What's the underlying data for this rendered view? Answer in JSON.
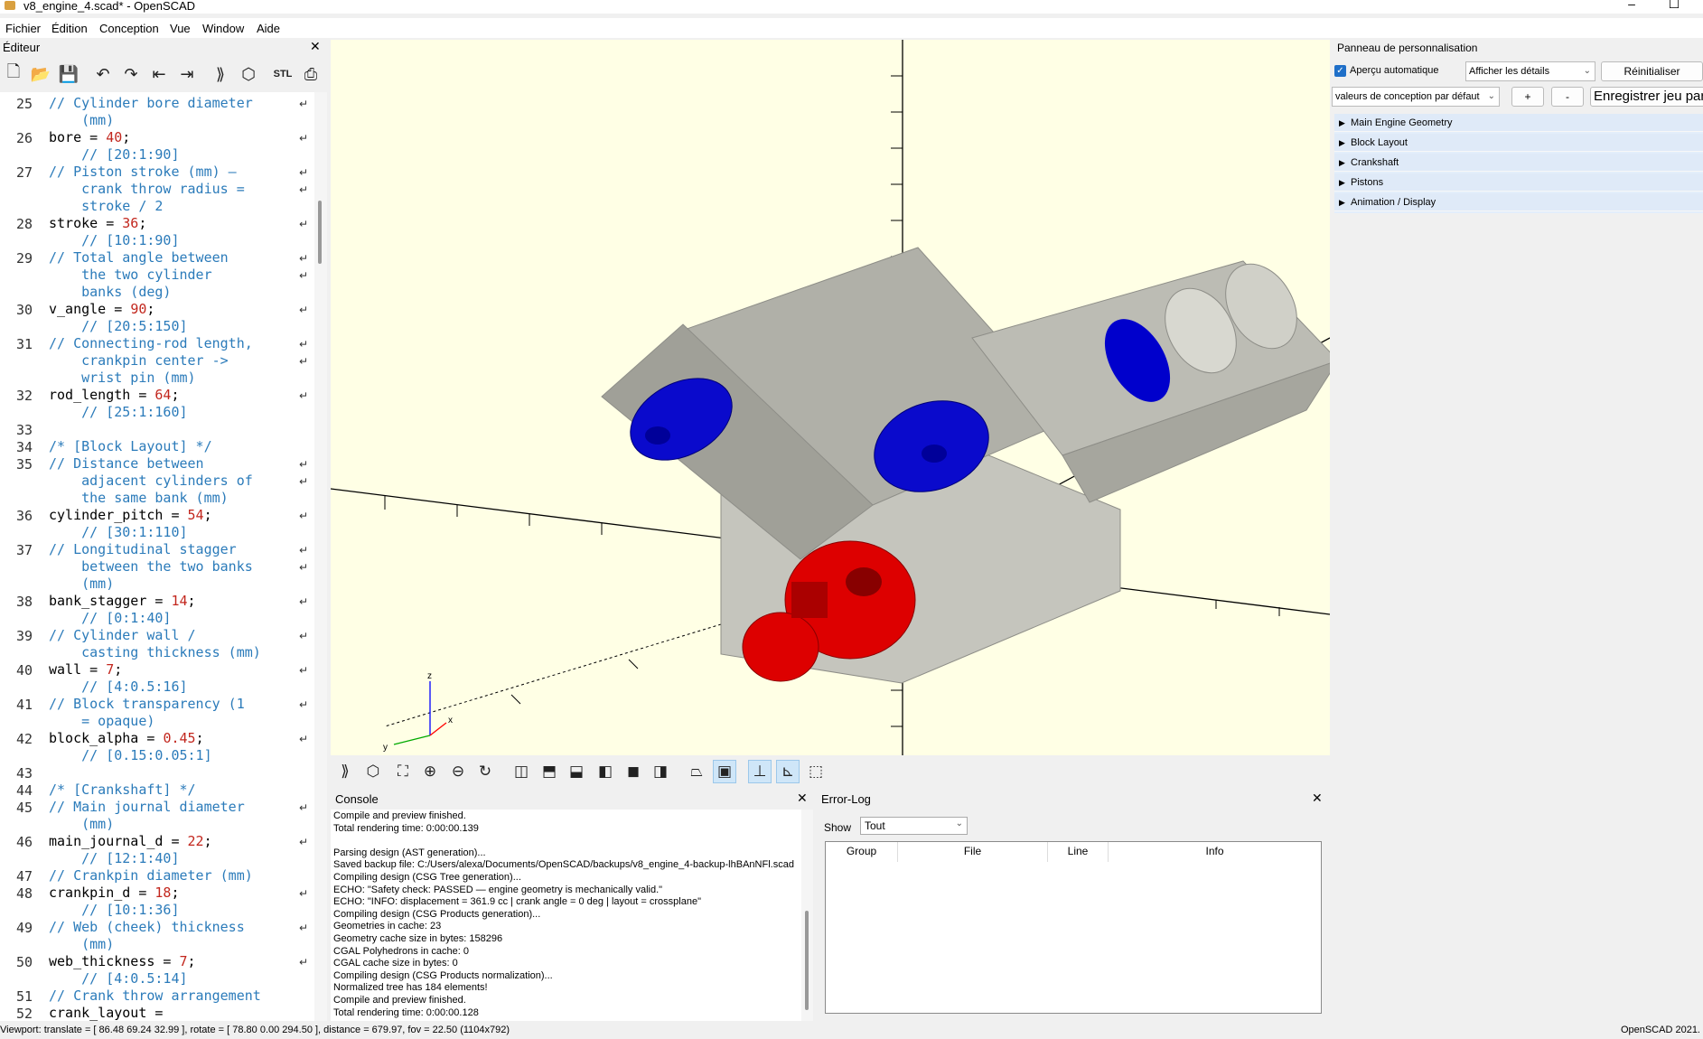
{
  "window": {
    "title": "v8_engine_4.scad* - OpenSCAD"
  },
  "menu": [
    "Fichier",
    "Édition",
    "Conception",
    "Vue",
    "Window",
    "Aide"
  ],
  "editor": {
    "title": "Éditeur",
    "lines": [
      {
        "n": "25",
        "t": "// Cylinder bore diameter",
        "type": "c"
      },
      {
        "n": "",
        "t": "    (mm)",
        "type": "c"
      },
      {
        "n": "26",
        "t": "bore = ",
        "v": "40",
        "type": "k"
      },
      {
        "n": "",
        "t": "    // [20:1:90]",
        "type": "c"
      },
      {
        "n": "27",
        "t": "// Piston stroke (mm) —",
        "type": "c"
      },
      {
        "n": "",
        "t": "    crank throw radius =",
        "type": "c"
      },
      {
        "n": "",
        "t": "    stroke / 2",
        "type": "c"
      },
      {
        "n": "28",
        "t": "stroke = ",
        "v": "36",
        "type": "k"
      },
      {
        "n": "",
        "t": "    // [10:1:90]",
        "type": "c"
      },
      {
        "n": "29",
        "t": "// Total angle between",
        "type": "c"
      },
      {
        "n": "",
        "t": "    the two cylinder",
        "type": "c"
      },
      {
        "n": "",
        "t": "    banks (deg)",
        "type": "c"
      },
      {
        "n": "30",
        "t": "v_angle = ",
        "v": "90",
        "type": "k"
      },
      {
        "n": "",
        "t": "    // [20:5:150]",
        "type": "c"
      },
      {
        "n": "31",
        "t": "// Connecting-rod length,",
        "type": "c"
      },
      {
        "n": "",
        "t": "    crankpin center ->",
        "type": "c"
      },
      {
        "n": "",
        "t": "    wrist pin (mm)",
        "type": "c"
      },
      {
        "n": "32",
        "t": "rod_length = ",
        "v": "64",
        "type": "k"
      },
      {
        "n": "",
        "t": "    // [25:1:160]",
        "type": "c"
      },
      {
        "n": "33",
        "t": "",
        "type": "k"
      },
      {
        "n": "34",
        "t": "/* [Block Layout] */",
        "type": "c"
      },
      {
        "n": "35",
        "t": "// Distance between",
        "type": "c"
      },
      {
        "n": "",
        "t": "    adjacent cylinders of",
        "type": "c"
      },
      {
        "n": "",
        "t": "    the same bank (mm)",
        "type": "c"
      },
      {
        "n": "36",
        "t": "cylinder_pitch = ",
        "v": "54",
        "type": "k"
      },
      {
        "n": "",
        "t": "    // [30:1:110]",
        "type": "c"
      },
      {
        "n": "37",
        "t": "// Longitudinal stagger",
        "type": "c"
      },
      {
        "n": "",
        "t": "    between the two banks",
        "type": "c"
      },
      {
        "n": "",
        "t": "    (mm)",
        "type": "c"
      },
      {
        "n": "38",
        "t": "bank_stagger = ",
        "v": "14",
        "type": "k"
      },
      {
        "n": "",
        "t": "    // [0:1:40]",
        "type": "c"
      },
      {
        "n": "39",
        "t": "// Cylinder wall /",
        "type": "c"
      },
      {
        "n": "",
        "t": "    casting thickness (mm)",
        "type": "c"
      },
      {
        "n": "40",
        "t": "wall = ",
        "v": "7",
        "type": "k"
      },
      {
        "n": "",
        "t": "    // [4:0.5:16]",
        "type": "c"
      },
      {
        "n": "41",
        "t": "// Block transparency (1",
        "type": "c"
      },
      {
        "n": "",
        "t": "    = opaque)",
        "type": "c"
      },
      {
        "n": "42",
        "t": "block_alpha = ",
        "v": "0.45",
        "type": "k"
      },
      {
        "n": "",
        "t": "    // [0.15:0.05:1]",
        "type": "c"
      },
      {
        "n": "43",
        "t": "",
        "type": "k"
      },
      {
        "n": "44",
        "t": "/* [Crankshaft] */",
        "type": "c"
      },
      {
        "n": "45",
        "t": "// Main journal diameter",
        "type": "c"
      },
      {
        "n": "",
        "t": "    (mm)",
        "type": "c"
      },
      {
        "n": "46",
        "t": "main_journal_d = ",
        "v": "22",
        "type": "k"
      },
      {
        "n": "",
        "t": "    // [12:1:40]",
        "type": "c"
      },
      {
        "n": "47",
        "t": "// Crankpin diameter (mm)",
        "type": "c"
      },
      {
        "n": "48",
        "t": "crankpin_d = ",
        "v": "18",
        "type": "k"
      },
      {
        "n": "",
        "t": "    // [10:1:36]",
        "type": "c"
      },
      {
        "n": "49",
        "t": "// Web (cheek) thickness",
        "type": "c"
      },
      {
        "n": "",
        "t": "    (mm)",
        "type": "c"
      },
      {
        "n": "50",
        "t": "web_thickness = ",
        "v": "7",
        "type": "k"
      },
      {
        "n": "",
        "t": "    // [4:0.5:14]",
        "type": "c"
      },
      {
        "n": "51",
        "t": "// Crank throw arrangement",
        "type": "c"
      },
      {
        "n": "52",
        "t": "crank_layout =",
        "type": "k"
      }
    ]
  },
  "console": {
    "title": "Console",
    "lines": [
      "Compile and preview finished.",
      "Total rendering time: 0:00:00.139",
      "",
      "Parsing design (AST generation)...",
      "Saved backup file: C:/Users/alexa/Documents/OpenSCAD/backups/v8_engine_4-backup-lhBAnNFl.scad",
      "Compiling design (CSG Tree generation)...",
      "ECHO: \"Safety check: PASSED — engine geometry is mechanically valid.\"",
      "ECHO: \"INFO: displacement = 361.9 cc | crank angle = 0 deg | layout = crossplane\"",
      "Compiling design (CSG Products generation)...",
      "Geometries in cache: 23",
      "Geometry cache size in bytes: 158296",
      "CGAL Polyhedrons in cache: 0",
      "CGAL cache size in bytes: 0",
      "Compiling design (CSG Products normalization)...",
      "Normalized tree has 184 elements!",
      "Compile and preview finished.",
      "Total rendering time: 0:00:00.128"
    ]
  },
  "errlog": {
    "title": "Error-Log",
    "show_label": "Show",
    "show_value": "Tout",
    "columns": [
      "Group",
      "File",
      "Line",
      "Info"
    ]
  },
  "customizer": {
    "title": "Panneau de personnalisation",
    "auto_preview": "Aperçu automatique",
    "details": "Afficher les détails",
    "reset": "Réinitialiser",
    "preset": "valeurs de conception par défaut",
    "plus": "+",
    "minus": "-",
    "save": "Enregistrer jeu par",
    "sections": [
      "Main Engine Geometry",
      "Block Layout",
      "Crankshaft",
      "Pistons",
      "Animation / Display"
    ]
  },
  "status": {
    "viewport": "Viewport: translate = [ 86.48 69.24 32.99 ], rotate = [ 78.80 0.00 294.50 ], distance = 679.97, fov = 22.50 (1104x792)",
    "version": "OpenSCAD 2021."
  },
  "axes": {
    "x": "x",
    "y": "y",
    "z": "z"
  },
  "colors": {
    "viewport_bg": "#ffffe5",
    "piston": "#0000cc",
    "crank": "#dd0000",
    "block": "#b8b8b0",
    "accent": "#1f6fc8"
  },
  "icons": {
    "editor_toolbar": [
      "new-file-icon",
      "open-file-icon",
      "save-icon",
      "undo-icon",
      "redo-icon",
      "unindent-icon",
      "indent-icon",
      "preview-icon",
      "render-icon",
      "export-stl-icon",
      "send-to-print-icon"
    ],
    "view_toolbar": [
      "preview-icon",
      "render-icon",
      "view-all-icon",
      "zoom-in-icon",
      "zoom-out-icon",
      "reset-view-icon",
      "view-right-icon",
      "view-top-icon",
      "view-bottom-icon",
      "view-left-icon",
      "view-front-icon",
      "view-back-icon",
      "perspective-icon",
      "orthogonal-icon",
      "show-axes-icon",
      "show-scale-icon",
      "show-edges-icon"
    ]
  }
}
